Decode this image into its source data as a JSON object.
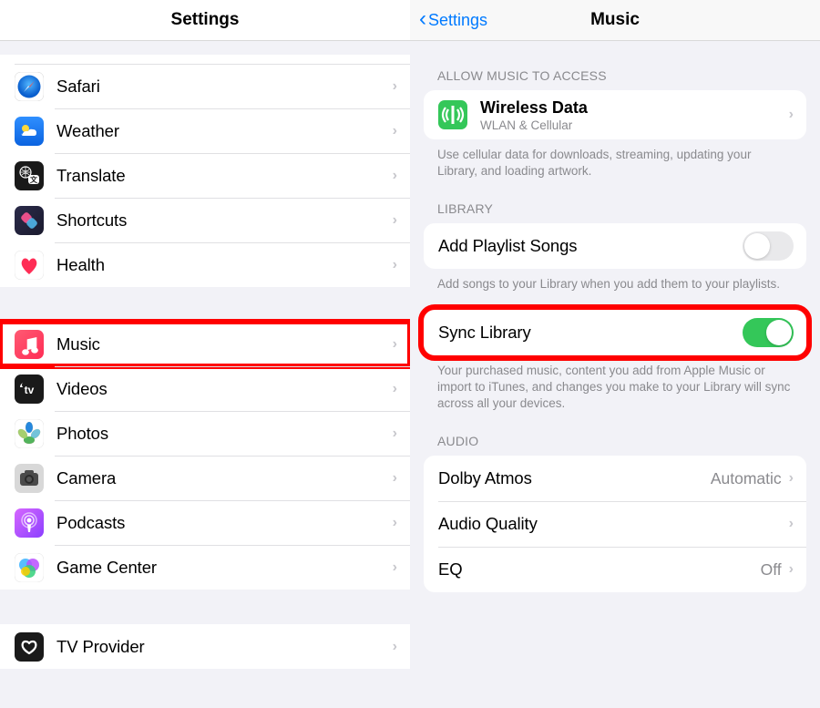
{
  "left": {
    "title": "Settings",
    "group1": [
      {
        "label": "Safari",
        "icon": "safari"
      },
      {
        "label": "Weather",
        "icon": "weather"
      },
      {
        "label": "Translate",
        "icon": "translate"
      },
      {
        "label": "Shortcuts",
        "icon": "shortcuts"
      },
      {
        "label": "Health",
        "icon": "health"
      }
    ],
    "group2": [
      {
        "label": "Music",
        "icon": "music",
        "highlight": true
      },
      {
        "label": "Videos",
        "icon": "videos"
      },
      {
        "label": "Photos",
        "icon": "photos"
      },
      {
        "label": "Camera",
        "icon": "camera"
      },
      {
        "label": "Podcasts",
        "icon": "podcasts"
      },
      {
        "label": "Game Center",
        "icon": "gamecenter"
      }
    ],
    "group3": [
      {
        "label": "TV Provider",
        "icon": "tvprovider"
      }
    ]
  },
  "right": {
    "back": "Settings",
    "title": "Music",
    "section_access": {
      "header": "ALLOW MUSIC TO ACCESS",
      "wireless_title": "Wireless Data",
      "wireless_sub": "WLAN & Cellular",
      "footer": "Use cellular data for downloads, streaming, updating your Library, and loading artwork."
    },
    "section_library": {
      "header": "LIBRARY",
      "add_label": "Add Playlist Songs",
      "add_footer": "Add songs to your Library when you add them to your playlists.",
      "sync_label": "Sync Library",
      "sync_footer": "Your purchased music, content you add from Apple Music or import to iTunes, and changes you make to your Library will sync across all your devices."
    },
    "section_audio": {
      "header": "AUDIO",
      "dolby_label": "Dolby Atmos",
      "dolby_value": "Automatic",
      "aq_label": "Audio Quality",
      "eq_label": "EQ",
      "eq_value": "Off"
    }
  }
}
